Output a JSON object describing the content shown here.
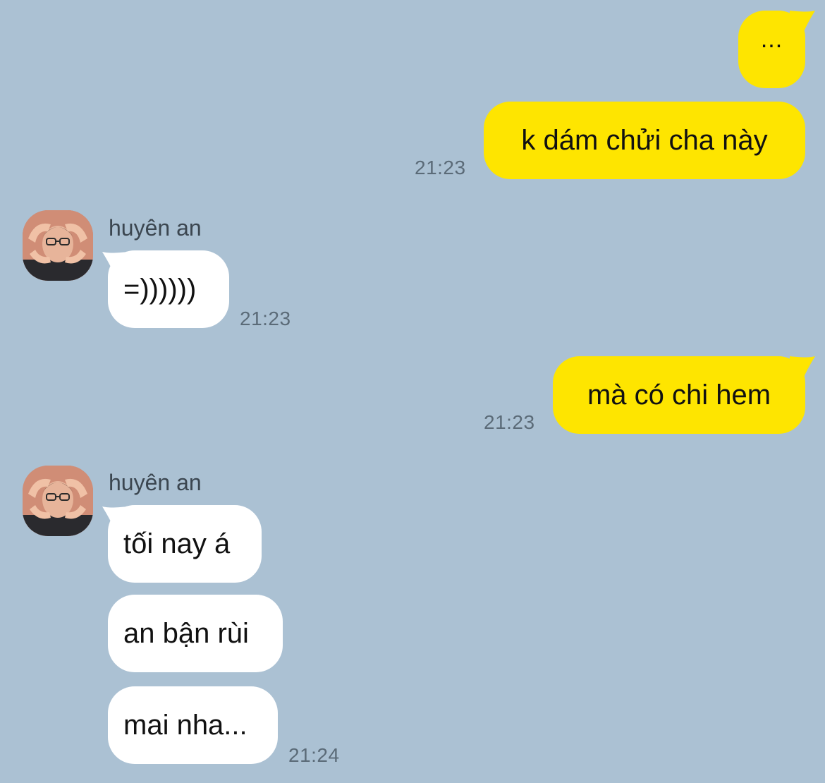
{
  "colors": {
    "background": "#abc1d3",
    "outgoing_bubble": "#fee500",
    "incoming_bubble": "#ffffff",
    "timestamp": "#5b6b78",
    "sender_name": "#3b4650"
  },
  "messages": [
    {
      "id": "m1",
      "direction": "out",
      "text": "..."
    },
    {
      "id": "m2",
      "direction": "out",
      "text": "k dám chửi cha này",
      "time": "21:23"
    },
    {
      "id": "m3",
      "direction": "in",
      "sender": "huyên an",
      "avatar": "profile-photo-heart-hands",
      "text": "=))))))",
      "time": "21:23"
    },
    {
      "id": "m4",
      "direction": "out",
      "text": "mà có chi hem",
      "time": "21:23"
    },
    {
      "id": "m5",
      "direction": "in",
      "sender": "huyên an",
      "avatar": "profile-photo-heart-hands",
      "text": "tối nay á"
    },
    {
      "id": "m6",
      "direction": "in",
      "text": "an bận rùi"
    },
    {
      "id": "m7",
      "direction": "in",
      "text": "mai nha...",
      "time": "21:24"
    }
  ]
}
